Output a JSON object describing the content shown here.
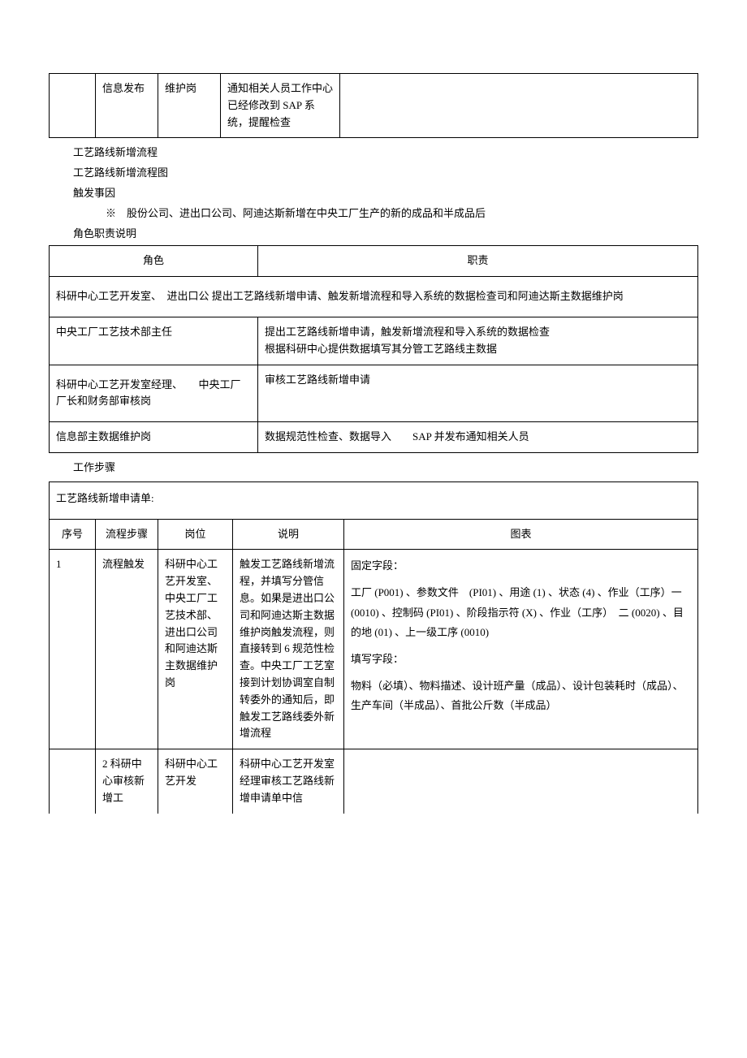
{
  "topTable": {
    "row": {
      "c1": "",
      "c2": "信息发布",
      "c3": "维护岗",
      "c4": "通知相关人员工作中心已经修改到 SAP 系统，提醒检查",
      "c5": ""
    }
  },
  "headings": {
    "h1": "工艺路线新增流程",
    "h2": "工艺路线新增流程图",
    "h3": "触发事因",
    "trigger": "※　股份公司、进出口公司、阿迪达斯新增在中央工厂生产的新的成品和半成品后",
    "h4": "角色职责说明",
    "h5": "工作步骤"
  },
  "roles": {
    "header": {
      "role": "角色",
      "duty": "职责"
    },
    "rows": [
      {
        "role": "科研中心工艺开发室、　进出口公 提出工艺路线新增申请、触发新增流程和导入系统的数据检查司和阿迪达斯主数据维护岗",
        "duty": ""
      },
      {
        "role": "中央工厂工艺技术部主任",
        "duty": "提出工艺路线新增申请，触发新增流程和导入系统的数据检查\n根据科研中心提供数据填写其分管工艺路线主数据"
      },
      {
        "role": "科研中心工艺开发室经理、　　中央工厂厂长和财务部审核岗",
        "duty": "审核工艺路线新增申请"
      },
      {
        "role": "信息部主数据维护岗",
        "duty": "数据规范性检查、数据导入　　SAP 并发布通知相关人员"
      }
    ]
  },
  "steps": {
    "formTitle": "工艺路线新增申请单:",
    "header": {
      "seq": "序号",
      "step": "流程步骤",
      "post": "岗位",
      "desc": "说明",
      "chart": "图表"
    },
    "rows": [
      {
        "seq": "1",
        "step": "流程触发",
        "post": "科研中心工艺开发室、中央工厂工艺技术部、进出口公司和阿迪达斯主数据维护岗",
        "desc": "触发工艺路线新增流程，并填写分管信息。如果是进出口公司和阿迪达斯主数据维护岗触发流程，则直接转到 6 规范性检查。中央工厂工艺室接到计划协调室自制转委外的通知后，即触发工艺路线委外新增流程",
        "chart": {
          "p1": "固定字段：",
          "p2": "工厂 (P001) 、参数文件　(PI01) 、用途 (1) 、状态 (4) 、作业（工序）一 (0010) 、控制码 (PI01) 、阶段指示符 (X) 、作业（工序）　二 (0020) 、目的地 (01) 、上一级工序 (0010)",
          "p3": "填写字段：",
          "p4": "物料（必填）、物料描述、设计班产量（成品）、设计包装耗时（成品）、生产车间（半成品）、首批公斤数（半成品）"
        }
      },
      {
        "seq": "",
        "step": "2 科研中心审核新增工",
        "post": "科研中心工艺开发",
        "desc": "科研中心工艺开发室经理审核工艺路线新增申请单中信",
        "chart": {
          "p1": ""
        }
      }
    ]
  }
}
